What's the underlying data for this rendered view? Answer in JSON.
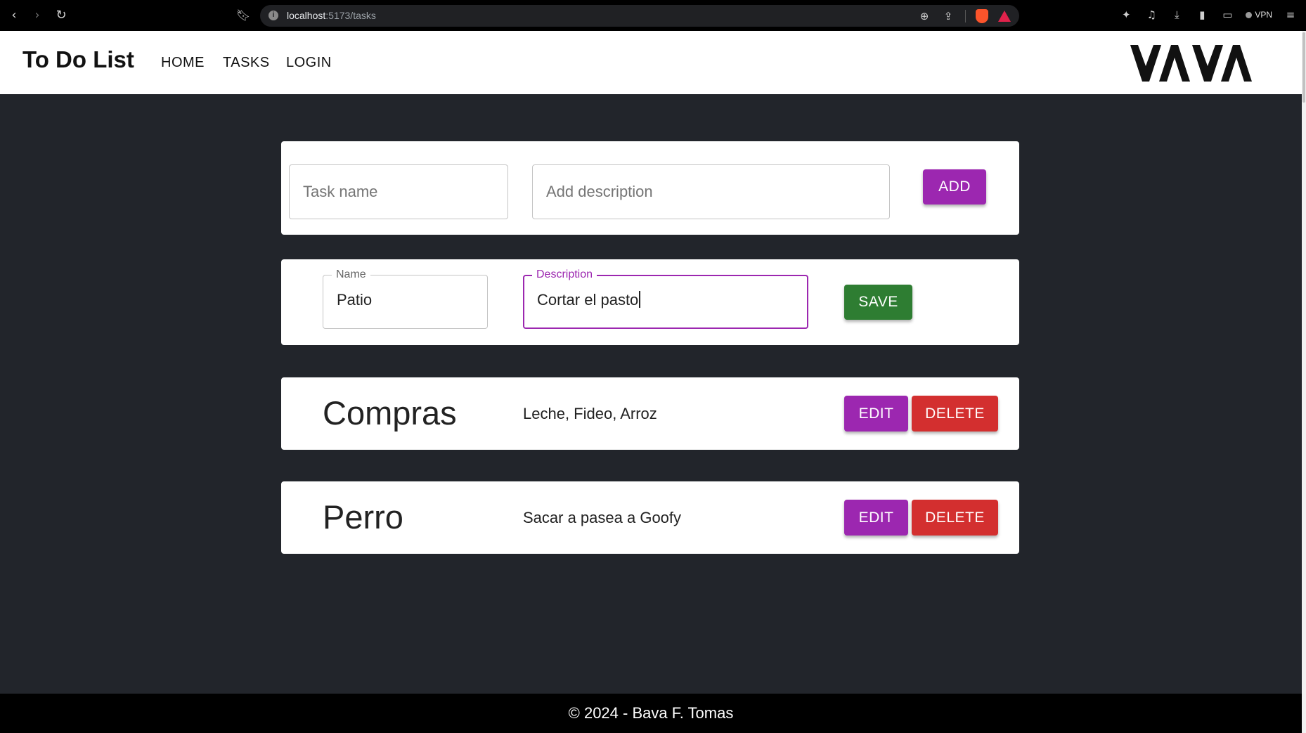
{
  "browser": {
    "url_host": "localhost",
    "url_path": ":5173/tasks",
    "vpn_label": "VPN"
  },
  "header": {
    "title": "To Do List",
    "nav": [
      "HOME",
      "TASKS",
      "LOGIN"
    ]
  },
  "add_form": {
    "name_placeholder": "Task name",
    "description_placeholder": "Add description",
    "add_label": "ADD"
  },
  "edit_form": {
    "name_label": "Name",
    "name_value": "Patio",
    "description_label": "Description",
    "description_value": "Cortar el pasto",
    "save_label": "SAVE"
  },
  "tasks": [
    {
      "title": "Compras",
      "description": "Leche, Fideo, Arroz",
      "edit_label": "EDIT",
      "delete_label": "DELETE"
    },
    {
      "title": "Perro",
      "description": "Sacar a pasea a Goofy",
      "edit_label": "EDIT",
      "delete_label": "DELETE"
    }
  ],
  "footer": {
    "text": "© 2024 - Bava F. Tomas"
  },
  "logo_text": "VAVA",
  "colors": {
    "primary": "#9c27b0",
    "success": "#2e7d32",
    "danger": "#d32f2f",
    "background": "#22252b"
  }
}
